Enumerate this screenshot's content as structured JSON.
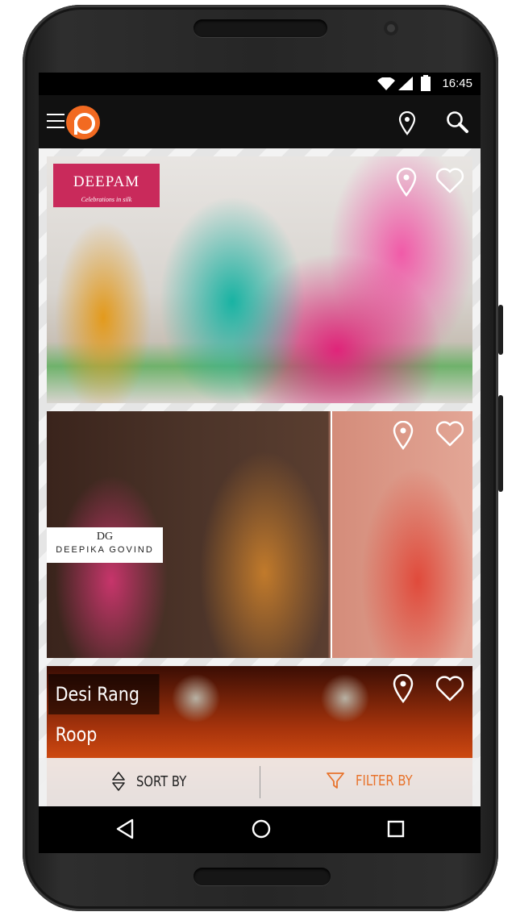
{
  "status_bar": {
    "time": "16:45",
    "icons": [
      "wifi-icon",
      "signal-icon",
      "battery-icon"
    ]
  },
  "app_bar": {
    "menu_icon": "menu-icon",
    "logo_icon": "app-logo-icon",
    "actions": [
      "location-pin-icon",
      "search-icon"
    ]
  },
  "cards": [
    {
      "brand": "DEEPAM",
      "tagline": "Celebrations in silk",
      "actions": [
        "location-pin-icon",
        "heart-icon"
      ]
    },
    {
      "brand_mark": "DG",
      "brand": "DEEPIKA GOVIND",
      "actions": [
        "location-pin-icon",
        "heart-icon"
      ]
    },
    {
      "brand": "Desi Rang Roop",
      "actions": [
        "location-pin-icon",
        "heart-icon"
      ]
    }
  ],
  "bottom_bar": {
    "sort_label": "SORT BY",
    "filter_label": "FILTER BY"
  },
  "nav_bar": {
    "buttons": [
      "back-icon",
      "home-icon",
      "recents-icon"
    ]
  },
  "colors": {
    "accent": "#e8732c",
    "logo": "#f26a21",
    "deepam_brand": "#c92a5b",
    "app_bar": "#111111"
  }
}
